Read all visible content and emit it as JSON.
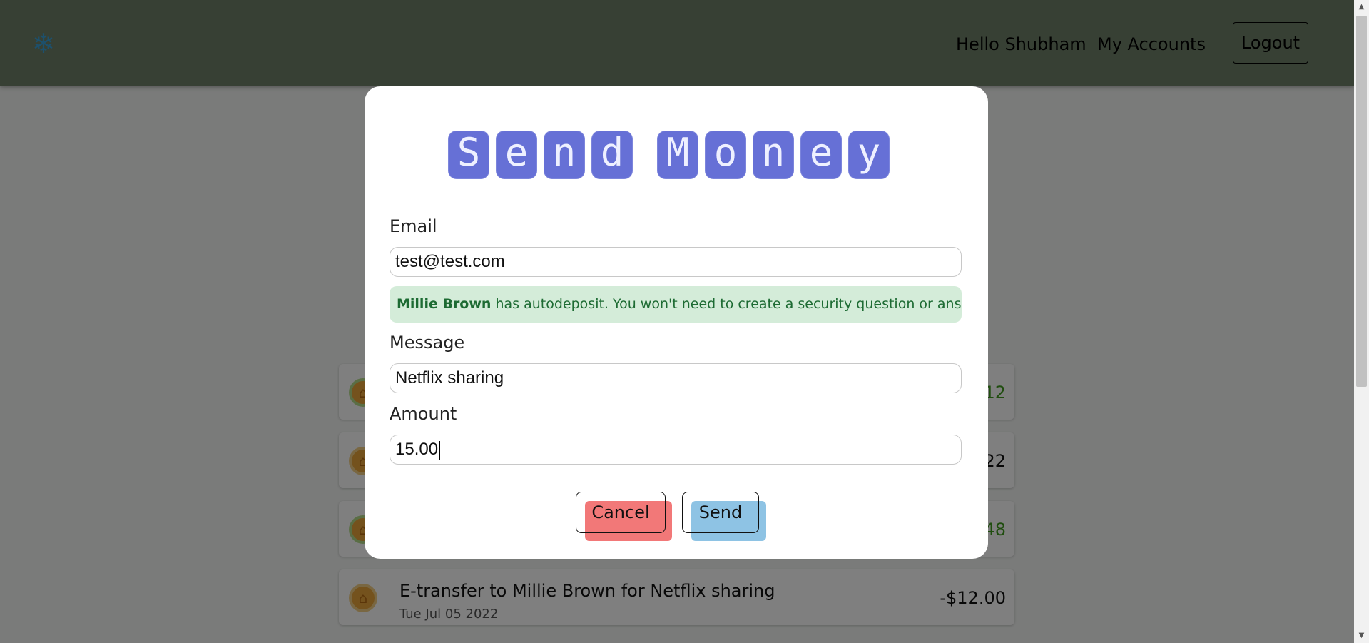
{
  "navbar": {
    "brand_icon": "snowflake-icon",
    "hello_text": "Hello Shubham",
    "accounts_link": "My Accounts",
    "logout_label": "Logout"
  },
  "transactions": [
    {
      "title": "",
      "date": "",
      "amount": "12",
      "type": "credit"
    },
    {
      "title": "",
      "date": "",
      "amount": "22",
      "type": "debit"
    },
    {
      "title": "",
      "date": "",
      "amount": "48",
      "type": "credit"
    },
    {
      "title": "E-transfer to Millie Brown for Netflix sharing",
      "date": "Tue Jul 05 2022",
      "amount": "-$12.00",
      "type": "debit"
    }
  ],
  "modal": {
    "title_letters_1": [
      "S",
      "e",
      "n",
      "d"
    ],
    "title_letters_2": [
      "M",
      "o",
      "n",
      "e",
      "y"
    ],
    "email_label": "Email",
    "email_value": "test@test.com",
    "notice_name": "Millie Brown",
    "notice_text": " has autodeposit. You won't need to create a security question or answer.",
    "message_label": "Message",
    "message_value": "Netflix sharing",
    "amount_label": "Amount",
    "amount_value": "15.00",
    "cancel_label": "Cancel",
    "send_label": "Send"
  },
  "colors": {
    "navbar": "#6e8068",
    "title_tile": "#6670d6",
    "notice_bg": "#d4ecd9",
    "notice_text": "#1d6b33",
    "cancel_bg": "#f27878",
    "send_bg": "#8ec3e4",
    "credit": "#3e9a1d"
  }
}
